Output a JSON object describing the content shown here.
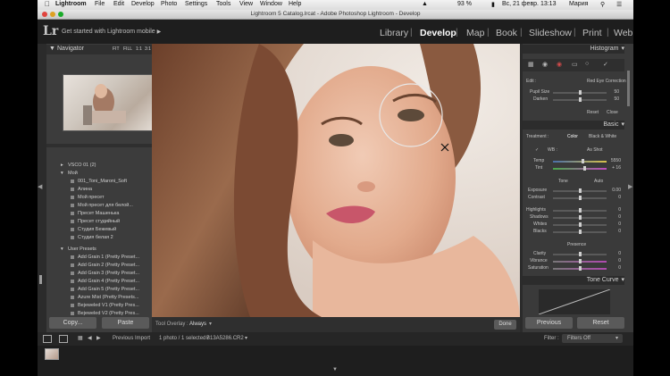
{
  "menubar": {
    "app": "Lightroom",
    "items": [
      "File",
      "Edit",
      "Develop",
      "Photo",
      "Settings",
      "Tools",
      "View",
      "Window",
      "Help"
    ],
    "battery": "93 %",
    "datetime": "Вс, 21 февр.  13:13",
    "user": "Мария"
  },
  "window": {
    "title": "Lightroom 5 Catalog.lrcat - Adobe Photoshop Lightroom - Develop"
  },
  "header": {
    "logo": "Lr",
    "mobile_prompt": "Get started with Lightroom mobile",
    "modules": [
      "Library",
      "Develop",
      "Map",
      "Book",
      "Slideshow",
      "Print",
      "Web"
    ],
    "active_module": "Develop"
  },
  "left_panel": {
    "navigator_title": "Navigator",
    "zoom_options": [
      "FIT",
      "FILL",
      "1:1",
      "3:1"
    ],
    "preset_groups": [
      {
        "label": "VSCO 01 (2)",
        "level": 0
      },
      {
        "label": "Мой",
        "level": 0
      }
    ],
    "presets": [
      "001_Toni_Maroni_Soft",
      "Алина",
      "Мой пресет",
      "Мой пресет для белой...",
      "Пресет Машенька",
      "Пресет студийный",
      "Студия Бежевый",
      "Студия белая 2"
    ],
    "user_presets_label": "User Presets",
    "user_presets": [
      "Add Grain 1 (Pretty Preset...",
      "Add Grain 2 (Pretty Preset...",
      "Add Grain 3 (Pretty Preset...",
      "Add Grain 4 (Pretty Preset...",
      "Add Grain 5 (Pretty Preset...",
      "Azure Mist (Pretty Presets...",
      "Bejeweled V1 (Pretty Pres...",
      "Bejeweled V2 (Pretty Pres..."
    ],
    "copy_label": "Copy...",
    "paste_label": "Paste"
  },
  "toolbar": {
    "tool_overlay_label": "Tool Overlay :",
    "tool_overlay_value": "Always",
    "done_label": "Done"
  },
  "right_panel": {
    "histogram_title": "Histogram",
    "redeye": {
      "edit_label": "Edit :",
      "mode_label": "Red Eye Correction",
      "pupil_label": "Pupil Size",
      "pupil_value": "50",
      "darken_label": "Darken",
      "darken_value": "50",
      "reset_label": "Reset",
      "close_label": "Close"
    },
    "basic_title": "Basic",
    "treatment_label": "Treatment :",
    "color_label": "Color",
    "bw_label": "Black & White",
    "wb_label": "WB :",
    "wb_value": "As Shot",
    "temp_label": "Temp",
    "temp_value": "5550",
    "tint_label": "Tint",
    "tint_value": "+ 16",
    "tone_label": "Tone",
    "auto_label": "Auto",
    "exposure_label": "Exposure",
    "exposure_value": "0.00",
    "contrast_label": "Contrast",
    "contrast_value": "0",
    "highlights_label": "Highlights",
    "highlights_value": "0",
    "shadows_label": "Shadows",
    "shadows_value": "0",
    "whites_label": "Whites",
    "whites_value": "0",
    "blacks_label": "Blacks",
    "blacks_value": "0",
    "presence_label": "Presence",
    "clarity_label": "Clarity",
    "clarity_value": "0",
    "vibrance_label": "Vibrance",
    "vibrance_value": "0",
    "saturation_label": "Saturation",
    "saturation_value": "0",
    "tonecurve_title": "Tone Curve",
    "previous_label": "Previous",
    "reset_label": "Reset"
  },
  "filmstrip": {
    "previous_import": "Previous Import",
    "info": "1 photo / 1 selected /",
    "filename": "B13A5286.CR2",
    "filter_label": "Filter :",
    "filter_value": "Filters Off"
  },
  "colors": {
    "panel": "#3c3c3c",
    "header": "#1e1e1e",
    "accent_red": "#d24a4a"
  }
}
